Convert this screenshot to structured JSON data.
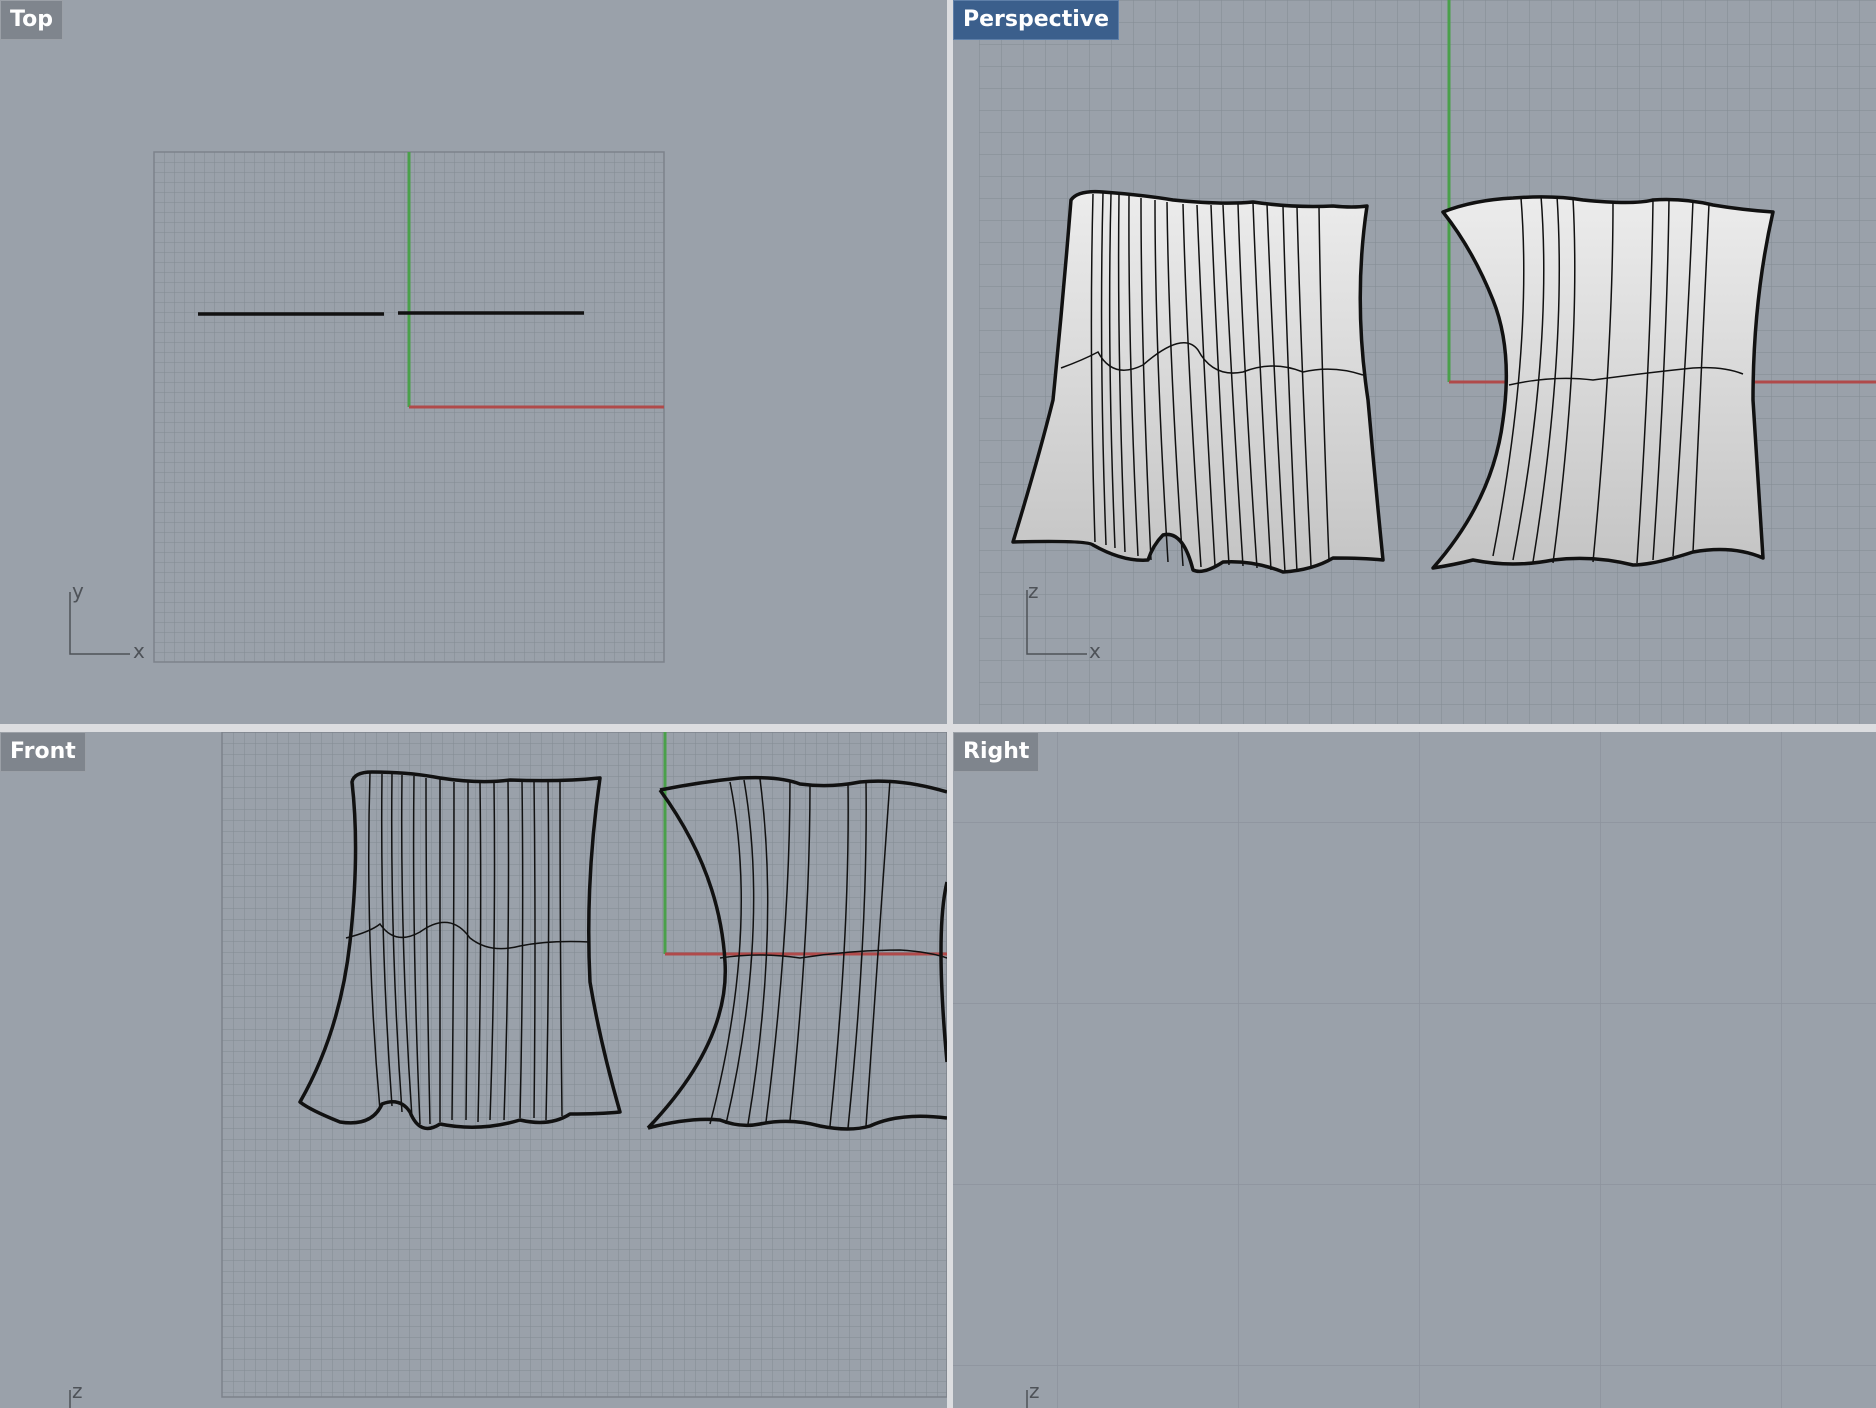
{
  "viewports": {
    "top": {
      "label": "Top",
      "axis_labels": {
        "h": "x",
        "v": "y"
      }
    },
    "perspective": {
      "label": "Perspective",
      "active": true,
      "axis_labels": {
        "h": "x",
        "v": "z"
      }
    },
    "front": {
      "label": "Front",
      "axis_labels": {
        "v": "z"
      }
    },
    "right": {
      "label": "Right",
      "axis_labels": {
        "v": "z"
      }
    }
  },
  "colors": {
    "viewport_bg": "#9aa1aa",
    "grid_minor": "#8a9099",
    "grid_major": "#7c828b",
    "x_axis": "#b04a4a",
    "y_axis": "#4aa04a",
    "active_label": "#3b5f8c",
    "label_bg": "#7f858d"
  },
  "icons": [
    "world-axes-icon"
  ]
}
